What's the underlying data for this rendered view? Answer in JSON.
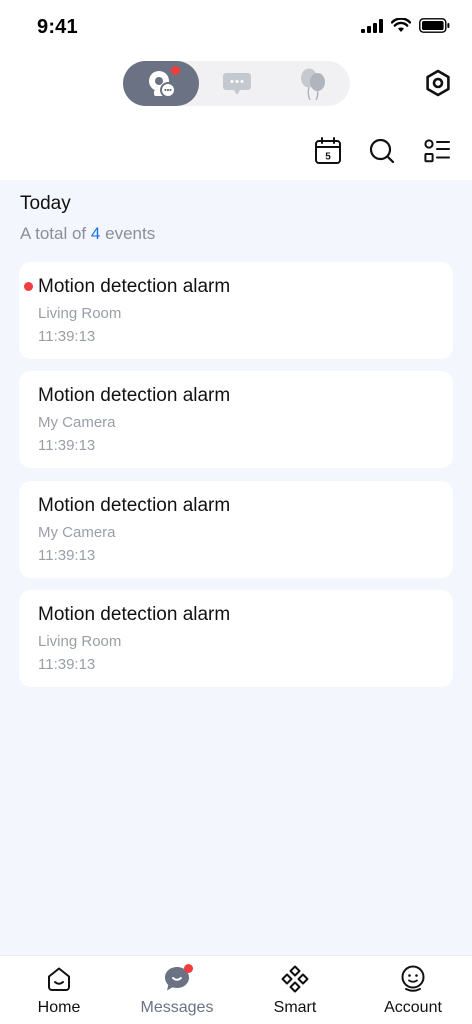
{
  "status_bar": {
    "time": "9:41"
  },
  "header": {
    "segments": [
      {
        "name": "camera-events",
        "icon": "camera-icon",
        "active": true,
        "badge": true
      },
      {
        "name": "messages",
        "icon": "chat-bubble-icon",
        "active": false,
        "badge": false
      },
      {
        "name": "notifications",
        "icon": "balloons-icon",
        "active": false,
        "badge": false
      }
    ],
    "settings_icon": "hexagon-settings-icon",
    "toolbar": {
      "calendar_day": "5"
    }
  },
  "events": {
    "section_title": "Today",
    "summary_prefix": "A total of",
    "summary_count": "4",
    "summary_suffix": "events",
    "items": [
      {
        "title": "Motion detection alarm",
        "location": "Living Room",
        "time": "11:39:13",
        "unread": true
      },
      {
        "title": "Motion detection alarm",
        "location": "My Camera",
        "time": "11:39:13",
        "unread": false
      },
      {
        "title": "Motion detection alarm",
        "location": "My Camera",
        "time": "11:39:13",
        "unread": false
      },
      {
        "title": "Motion detection alarm",
        "location": "Living Room",
        "time": "11:39:13",
        "unread": false
      }
    ]
  },
  "tabbar": {
    "items": [
      {
        "label": "Home",
        "icon": "home-icon",
        "active": false
      },
      {
        "label": "Messages",
        "icon": "messages-icon",
        "active": true,
        "badge": true
      },
      {
        "label": "Smart",
        "icon": "smart-icon",
        "active": false
      },
      {
        "label": "Account",
        "icon": "account-icon",
        "active": false
      }
    ]
  },
  "colors": {
    "accent": "#1a73e8",
    "badge": "#f03e3e",
    "active_segment": "#6b7283",
    "background": "#f3f6fc"
  }
}
